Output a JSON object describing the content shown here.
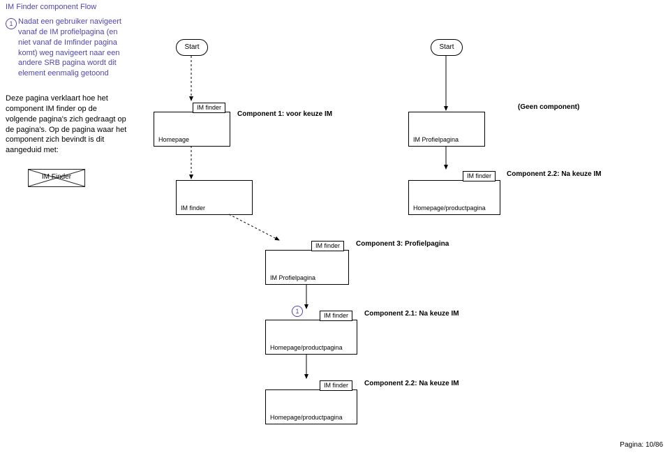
{
  "title": "IM Finder component Flow",
  "note_badge": "1",
  "note_p1": "Nadat een gebruiker navigeert vanaf de IM profielpagina (en niet vanaf de Imfinder pagina komt) weg navigeert naar een andere SRB pagina wordt dit element eenmalig getoond",
  "note_p2": "Deze pagina verklaart hoe het component IM finder op de volgende pagina's zich gedraagt op de pagina's. Op de pagina waar het component zich bevindt is dit aangeduid met:",
  "imfinder_sym": "IM Finder",
  "start": "Start",
  "tab_imfinder": "IM finder",
  "box_homepage": "Homepage",
  "box_profiel": "IM Profielpagina",
  "box_homeprod": "Homepage/productpagina",
  "lbl_c1": "Component 1: voor keuze IM",
  "lbl_none": "(Geen component)",
  "lbl_c22": "Component 2.2: Na keuze IM",
  "lbl_c3": "Component 3: Profielpagina",
  "lbl_c21": "Component 2.1: Na keuze IM",
  "badge_c21": "1",
  "footer": "Pagina: 10/86"
}
